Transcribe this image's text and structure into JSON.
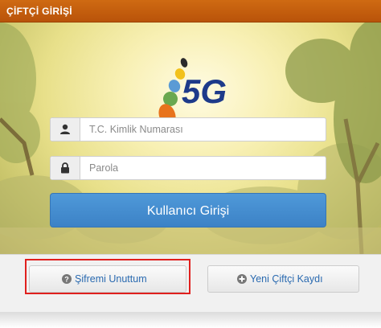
{
  "panel": {
    "title": "ÇİFTÇİ GİRİŞİ"
  },
  "logo": {
    "text": "5G",
    "icon": "5g-logo"
  },
  "form": {
    "id_field": {
      "placeholder": "T.C. Kimlik Numarası",
      "value": "",
      "icon": "user-icon"
    },
    "password_field": {
      "placeholder": "Parola",
      "value": "",
      "icon": "lock-icon"
    },
    "login_button": "Kullanıcı Girişi"
  },
  "footer": {
    "forgot_password": {
      "label": "Şifremi Unuttum",
      "icon": "question-circle-icon"
    },
    "register": {
      "label": "Yeni Çiftçi Kaydı",
      "icon": "plus-circle-icon"
    }
  },
  "colors": {
    "title_bar": "#c25e0e",
    "login_button": "#428bca",
    "link_text": "#2a6ab0",
    "highlight_border": "#e0201e"
  }
}
